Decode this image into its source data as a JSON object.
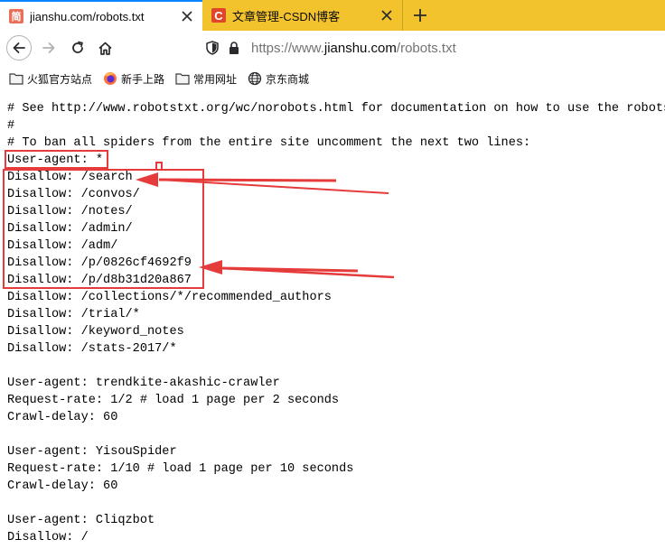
{
  "tabs": [
    {
      "favicon_text": "简",
      "title": "jianshu.com/robots.txt",
      "active": true
    },
    {
      "favicon_text": "C",
      "title": "文章管理-CSDN博客",
      "active": false
    }
  ],
  "new_tab_icon": "plus-icon",
  "nav": {
    "back_icon": "arrow-left-icon",
    "forward_icon": "arrow-right-icon",
    "reload_icon": "reload-icon",
    "home_icon": "home-icon"
  },
  "urlbar": {
    "prefix": "https://www.",
    "domain": "jianshu.com",
    "path": "/robots.txt"
  },
  "bookmarks": [
    {
      "icon": "folder-icon",
      "label": "火狐官方站点"
    },
    {
      "icon": "firefox-icon",
      "label": "新手上路"
    },
    {
      "icon": "folder-icon",
      "label": "常用网址"
    },
    {
      "icon": "globe-icon",
      "label": "京东商城"
    }
  ],
  "robots_lines": [
    "# See http://www.robotstxt.org/wc/norobots.html for documentation on how to use the robots.txt file",
    "#",
    "# To ban all spiders from the entire site uncomment the next two lines:",
    "User-agent: *",
    "Disallow: /search",
    "Disallow: /convos/",
    "Disallow: /notes/",
    "Disallow: /admin/",
    "Disallow: /adm/",
    "Disallow: /p/0826cf4692f9",
    "Disallow: /p/d8b31d20a867",
    "Disallow: /collections/*/recommended_authors",
    "Disallow: /trial/*",
    "Disallow: /keyword_notes",
    "Disallow: /stats-2017/*",
    "",
    "User-agent: trendkite-akashic-crawler",
    "Request-rate: 1/2 # load 1 page per 2 seconds",
    "Crawl-delay: 60",
    "",
    "User-agent: YisouSpider",
    "Request-rate: 1/10 # load 1 page per 10 seconds",
    "Crawl-delay: 60",
    "",
    "User-agent: Cliqzbot",
    "Disallow: /"
  ],
  "annotation_color": "#e53b3b",
  "accent_color": "#0a84ff",
  "tabstrip_color": "#f2c32c"
}
